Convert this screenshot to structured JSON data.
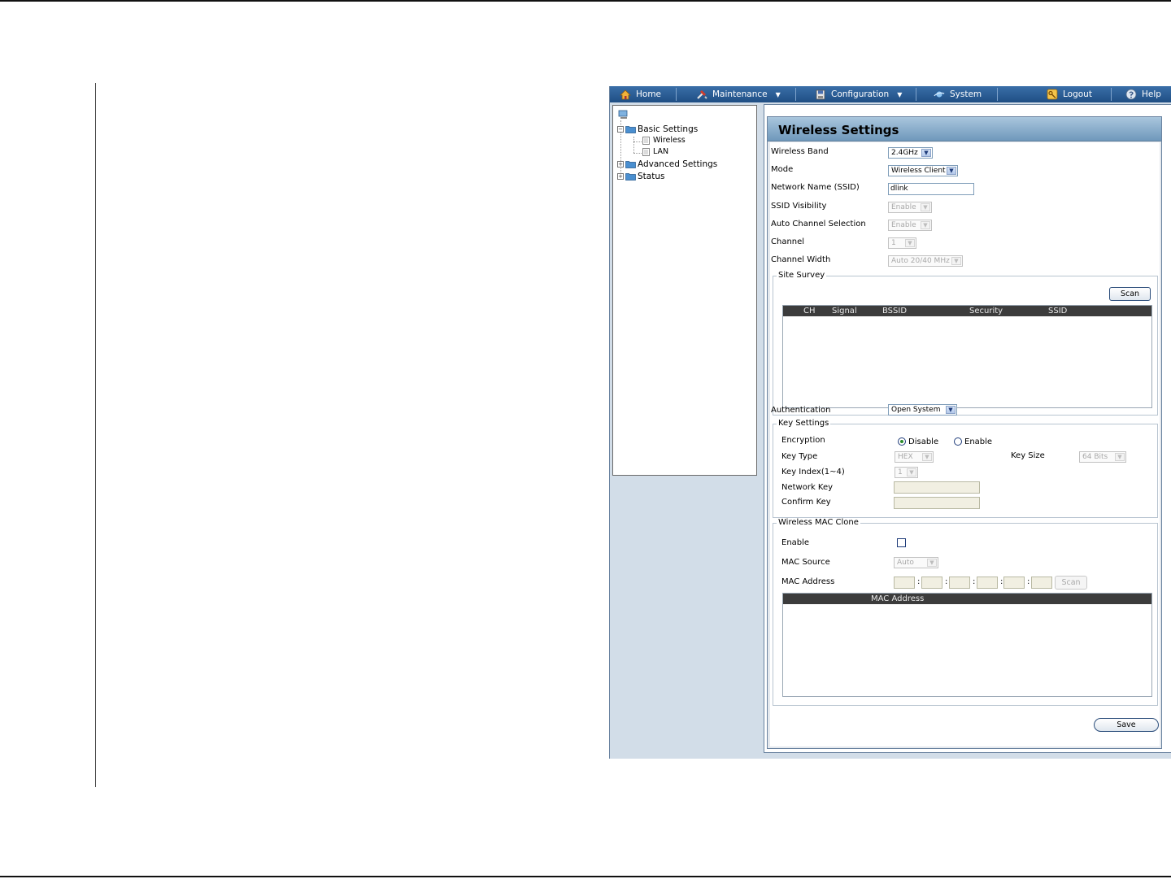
{
  "menu": {
    "home": "Home",
    "maintenance": "Maintenance",
    "configuration": "Configuration",
    "system": "System",
    "logout": "Logout",
    "help": "Help"
  },
  "tree": {
    "basic_settings": "Basic Settings",
    "wireless": "Wireless",
    "lan": "LAN",
    "advanced_settings": "Advanced Settings",
    "status": "Status"
  },
  "page": {
    "title": "Wireless Settings"
  },
  "fields": {
    "wireless_band": {
      "label": "Wireless Band",
      "value": "2.4GHz"
    },
    "mode": {
      "label": "Mode",
      "value": "Wireless Client"
    },
    "ssid": {
      "label": "Network Name (SSID)",
      "value": "dlink"
    },
    "ssid_visibility": {
      "label": "SSID Visibility",
      "value": "Enable"
    },
    "auto_channel": {
      "label": "Auto Channel Selection",
      "value": "Enable"
    },
    "channel": {
      "label": "Channel",
      "value": "1"
    },
    "channel_width": {
      "label": "Channel Width",
      "value": "Auto 20/40 MHz"
    },
    "authentication": {
      "label": "Authentication",
      "value": "Open System"
    }
  },
  "site_survey": {
    "legend": "Site Survey",
    "scan_label": "Scan",
    "columns": [
      "CH",
      "Signal",
      "BSSID",
      "Security",
      "SSID"
    ]
  },
  "key_settings": {
    "legend": "Key Settings",
    "encryption_label": "Encryption",
    "disable_label": "Disable",
    "enable_label": "Enable",
    "encryption_selected": "Disable",
    "key_type_label": "Key Type",
    "key_type_value": "HEX",
    "key_size_label": "Key Size",
    "key_size_value": "64 Bits",
    "key_index_label": "Key Index(1~4)",
    "key_index_value": "1",
    "network_key_label": "Network Key",
    "confirm_key_label": "Confirm Key"
  },
  "mac_clone": {
    "legend": "Wireless MAC Clone",
    "enable_label": "Enable",
    "mac_source_label": "MAC Source",
    "mac_source_value": "Auto",
    "mac_address_label": "MAC Address",
    "scan_label": "Scan",
    "separator": ":",
    "table_header": "MAC Address"
  },
  "actions": {
    "save_label": "Save"
  },
  "colors": {
    "menubar": "#1f4e84",
    "title_bar": "#8fb1cf",
    "panel_bg": "#d2dde8"
  }
}
